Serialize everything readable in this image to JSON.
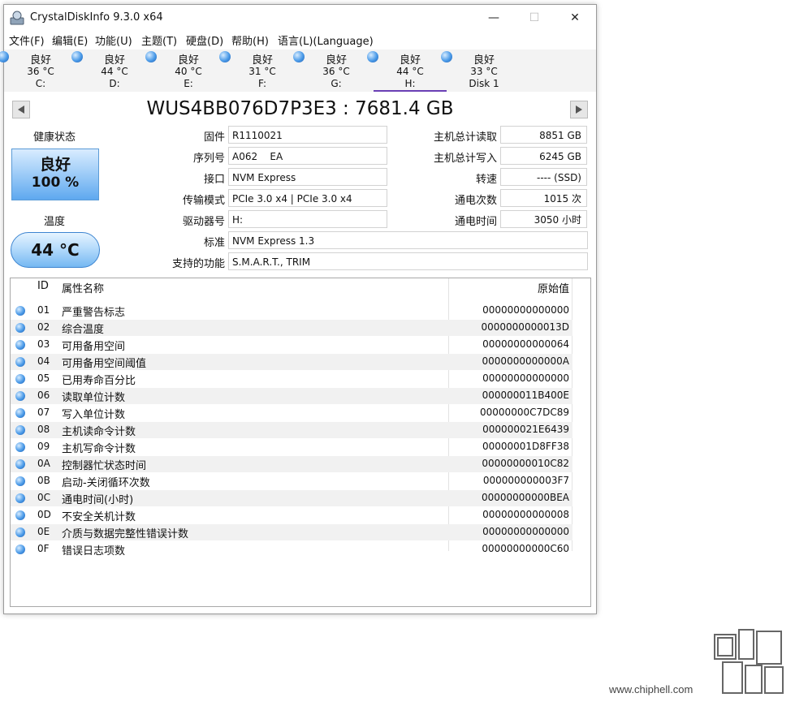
{
  "window": {
    "title": "CrystalDiskInfo 9.3.0 x64",
    "min": "—",
    "max": "☐",
    "close": "✕"
  },
  "menu": [
    "文件(F)",
    "编辑(E)",
    "功能(U)",
    "主题(T)",
    "硬盘(D)",
    "帮助(H)",
    "语言(L)(Language)"
  ],
  "drives": [
    {
      "status": "良好",
      "temp": "36 °C",
      "letter": "C:"
    },
    {
      "status": "良好",
      "temp": "44 °C",
      "letter": "D:"
    },
    {
      "status": "良好",
      "temp": "40 °C",
      "letter": "E:"
    },
    {
      "status": "良好",
      "temp": "31 °C",
      "letter": "F:"
    },
    {
      "status": "良好",
      "temp": "36 °C",
      "letter": "G:"
    },
    {
      "status": "良好",
      "temp": "44 °C",
      "letter": "H:"
    },
    {
      "status": "良好",
      "temp": "33 °C",
      "letter": "Disk 1"
    }
  ],
  "model": "WUS4BB076D7P3E3 : 7681.4 GB",
  "health": {
    "label": "健康状态",
    "status": "良好",
    "percent": "100 %"
  },
  "temperature": {
    "label": "温度",
    "value": "44 °C"
  },
  "info": {
    "firmware": {
      "label": "固件",
      "value": "R1110021"
    },
    "serial": {
      "label": "序列号",
      "value": "A062    EA"
    },
    "interface": {
      "label": "接口",
      "value": "NVM Express"
    },
    "transfer": {
      "label": "传输模式",
      "value": "PCIe 3.0 x4 | PCIe 3.0 x4"
    },
    "drive_letter": {
      "label": "驱动器号",
      "value": "H:"
    },
    "standard": {
      "label": "标准",
      "value": "NVM Express 1.3"
    },
    "features": {
      "label": "支持的功能",
      "value": "S.M.A.R.T., TRIM"
    },
    "host_reads": {
      "label": "主机总计读取",
      "value": "8851 GB"
    },
    "host_writes": {
      "label": "主机总计写入",
      "value": "6245 GB"
    },
    "rotation": {
      "label": "转速",
      "value": "---- (SSD)"
    },
    "power_count": {
      "label": "通电次数",
      "value": "1015 次"
    },
    "power_hours": {
      "label": "通电时间",
      "value": "3050 小时"
    }
  },
  "table": {
    "headers": {
      "id": "ID",
      "name": "属性名称",
      "raw": "原始值"
    },
    "rows": [
      {
        "id": "01",
        "name": "严重警告标志",
        "raw": "00000000000000"
      },
      {
        "id": "02",
        "name": "综合温度",
        "raw": "0000000000013D"
      },
      {
        "id": "03",
        "name": "可用备用空间",
        "raw": "00000000000064"
      },
      {
        "id": "04",
        "name": "可用备用空间阈值",
        "raw": "0000000000000A"
      },
      {
        "id": "05",
        "name": "已用寿命百分比",
        "raw": "00000000000000"
      },
      {
        "id": "06",
        "name": "读取单位计数",
        "raw": "000000011B400E"
      },
      {
        "id": "07",
        "name": "写入单位计数",
        "raw": "00000000C7DC89"
      },
      {
        "id": "08",
        "name": "主机读命令计数",
        "raw": "000000021E6439"
      },
      {
        "id": "09",
        "name": "主机写命令计数",
        "raw": "00000001D8FF38"
      },
      {
        "id": "0A",
        "name": "控制器忙状态时间",
        "raw": "00000000010C82"
      },
      {
        "id": "0B",
        "name": "启动-关闭循环次数",
        "raw": "000000000003F7"
      },
      {
        "id": "0C",
        "name": "通电时间(小时)",
        "raw": "00000000000BEA"
      },
      {
        "id": "0D",
        "name": "不安全关机计数",
        "raw": "00000000000008"
      },
      {
        "id": "0E",
        "name": "介质与数据完整性错误计数",
        "raw": "00000000000000"
      },
      {
        "id": "0F",
        "name": "错误日志项数",
        "raw": "00000000000C60"
      }
    ]
  },
  "watermark": {
    "text": "www.chiphell.com"
  }
}
